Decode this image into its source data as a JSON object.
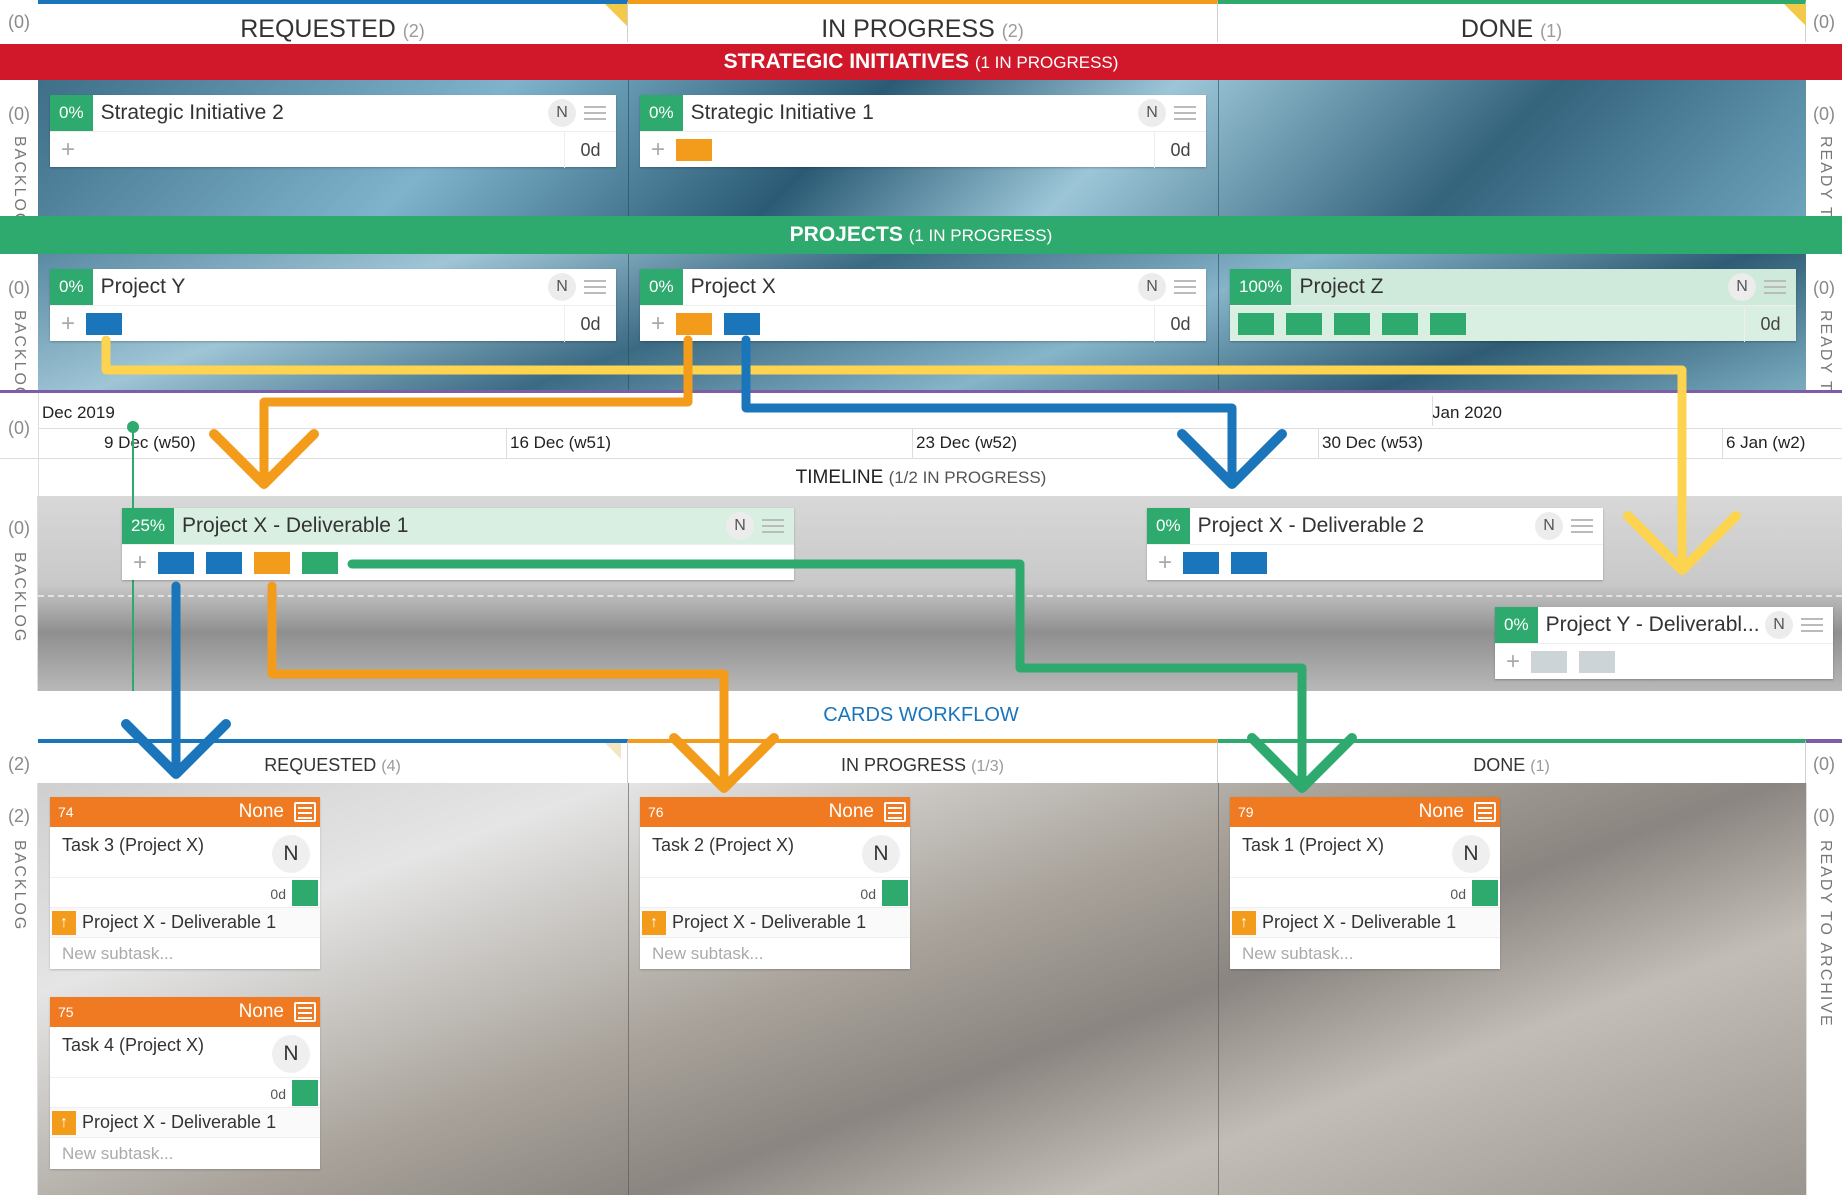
{
  "top_header": {
    "left_count": "(0)",
    "right_count": "(0)",
    "columns": [
      {
        "label": "REQUESTED",
        "count": "(2)",
        "color": "#1a75bb"
      },
      {
        "label": "IN PROGRESS",
        "count": "(2)",
        "color": "#f39c1b"
      },
      {
        "label": "DONE",
        "count": "(1)",
        "color": "#2eaa6e"
      }
    ]
  },
  "strategic": {
    "title": "STRATEGIC INITIATIVES",
    "sub": "(1 IN PROGRESS)",
    "color": "#d0182a",
    "left_count": "(0)",
    "right_count": "(0)",
    "left_lane": "BACKLOG",
    "right_lane": "READY TO",
    "cards": [
      {
        "pct": "0%",
        "title": "Strategic Initiative 2",
        "owner": "N",
        "plus": "+",
        "duration": "0d"
      },
      {
        "pct": "0%",
        "title": "Strategic Initiative 1",
        "owner": "N",
        "plus": "+",
        "duration": "0d"
      }
    ]
  },
  "projects": {
    "title": "PROJECTS",
    "sub": "(1 IN PROGRESS)",
    "color": "#2eaa6e",
    "left_count": "(0)",
    "right_count": "(0)",
    "left_lane": "BACKLOG",
    "right_lane": "READY TO",
    "cards": [
      {
        "pct": "0%",
        "title": "Project Y",
        "owner": "N",
        "plus": "+",
        "duration": "0d"
      },
      {
        "pct": "0%",
        "title": "Project X",
        "owner": "N",
        "plus": "+",
        "duration": "0d"
      },
      {
        "pct": "100%",
        "title": "Project Z",
        "owner": "N",
        "duration": "0d"
      }
    ]
  },
  "timeline": {
    "left_count": "(0)",
    "months": [
      "Dec 2019",
      "Jan 2020"
    ],
    "weeks": [
      "9 Dec (w50)",
      "16 Dec (w51)",
      "23 Dec (w52)",
      "30 Dec (w53)",
      "6 Jan (w2)"
    ],
    "title": "TIMELINE",
    "sub": "(1/2 IN PROGRESS)",
    "lane_count": "(0)",
    "lane": "BACKLOG",
    "cards": [
      {
        "pct": "25%",
        "title": "Project X - Deliverable 1",
        "owner": "N",
        "plus": "+"
      },
      {
        "pct": "0%",
        "title": "Project X - Deliverable 2",
        "owner": "N",
        "plus": "+"
      },
      {
        "pct": "0%",
        "title": "Project Y - Deliverabl...",
        "owner": "N",
        "plus": "+"
      }
    ]
  },
  "workflow": {
    "title": "CARDS WORKFLOW",
    "left_count": "(2)",
    "right_count": "(0)",
    "columns": [
      {
        "label": "REQUESTED",
        "count": "(4)"
      },
      {
        "label": "IN PROGRESS",
        "count": "(1/3)"
      },
      {
        "label": "DONE",
        "count": "(1)"
      }
    ],
    "lane_left_count": "(2)",
    "lane_left": "BACKLOG",
    "lane_right_count": "(0)",
    "lane_right": "READY TO ARCHIVE",
    "cards": [
      {
        "id": "74",
        "priority": "None",
        "title": "Task 3 (Project X)",
        "owner": "N",
        "duration": "0d",
        "link": "Project X - Deliverable 1",
        "subtask": "New subtask..."
      },
      {
        "id": "75",
        "priority": "None",
        "title": "Task 4 (Project X)",
        "owner": "N",
        "duration": "0d",
        "link": "Project X - Deliverable 1",
        "subtask": "New subtask..."
      },
      {
        "id": "76",
        "priority": "None",
        "title": "Task 2 (Project X)",
        "owner": "N",
        "duration": "0d",
        "link": "Project X - Deliverable 1",
        "subtask": "New subtask..."
      },
      {
        "id": "79",
        "priority": "None",
        "title": "Task 1 (Project X)",
        "owner": "N",
        "duration": "0d",
        "link": "Project X - Deliverable 1",
        "subtask": "New subtask..."
      }
    ]
  },
  "icons": {
    "menu": "hamburger-menu-icon",
    "arrow": "up-arrow-icon",
    "add": "plus-icon"
  },
  "colors": {
    "blue": "#1a75bb",
    "orange": "#f39c1b",
    "green": "#2eaa6e",
    "yellow": "#fcd44f",
    "red": "#d0182a",
    "task_header": "#f07a22"
  }
}
